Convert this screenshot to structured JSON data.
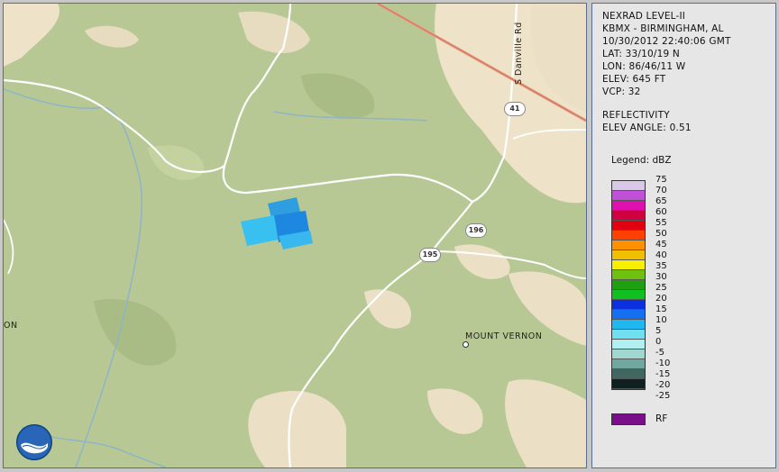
{
  "panel": {
    "product": "NEXRAD LEVEL-II",
    "station": "KBMX - BIRMINGHAM, AL",
    "datetime": "10/30/2012 22:40:06 GMT",
    "lat": "LAT: 33/10/19 N",
    "lon": "LON: 86/46/11 W",
    "elev": "ELEV: 645 FT",
    "vcp": "VCP: 32",
    "mode": "REFLECTIVITY",
    "elev_angle": "ELEV ANGLE: 0.51",
    "legend_title": "Legend: dBZ",
    "legend_labels": [
      "75",
      "70",
      "65",
      "60",
      "55",
      "50",
      "45",
      "40",
      "35",
      "30",
      "25",
      "20",
      "15",
      "10",
      "5",
      "0",
      "-5",
      "-10",
      "-15",
      "-20",
      "-25"
    ],
    "legend_colors": [
      "#d9c8e8",
      "#c050d8",
      "#e010b0",
      "#d00040",
      "#e00010",
      "#ff4000",
      "#ff9000",
      "#f0c000",
      "#f8f000",
      "#70c010",
      "#20a010",
      "#10c020",
      "#0a30e0",
      "#1470f0",
      "#20b8f0",
      "#70e0f0",
      "#b0f0f0",
      "#a0d8d0",
      "#70a8a0",
      "#406860",
      "#102020"
    ],
    "rf_label": "RF",
    "rf_color": "#7a0f8a"
  },
  "map": {
    "road_shields": [
      "41",
      "196",
      "195"
    ],
    "road_label": "S Danville Rd",
    "place_label": "MOUNT VERNON",
    "edge_label": "ON",
    "logo": "NOAA"
  }
}
